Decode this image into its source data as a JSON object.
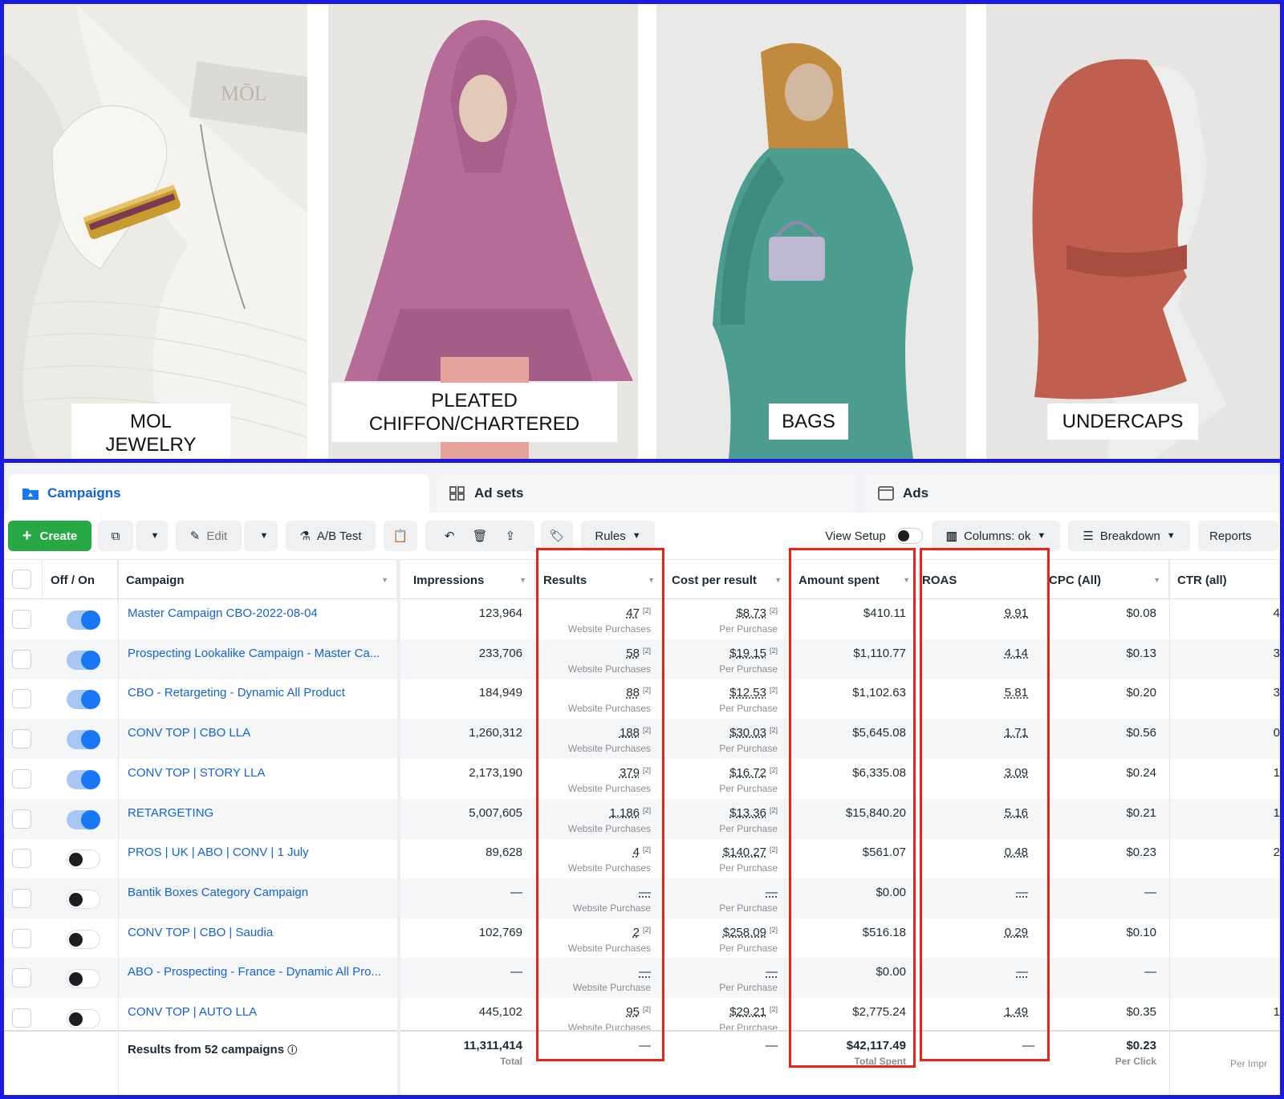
{
  "photos": [
    {
      "caption": "MOL JEWELRY"
    },
    {
      "caption_line1": "PLEATED",
      "caption_line2": "CHIFFON/CHARTERED"
    },
    {
      "caption": "BAGS"
    },
    {
      "caption": "UNDERCAPS"
    }
  ],
  "tabs": {
    "campaigns": "Campaigns",
    "adsets": "Ad sets",
    "ads": "Ads"
  },
  "toolbar": {
    "create": "Create",
    "edit": "Edit",
    "ab_test": "A/B Test",
    "rules": "Rules",
    "view_setup": "View Setup",
    "columns": "Columns: ok",
    "breakdown": "Breakdown",
    "reports": "Reports"
  },
  "columns": {
    "offon": "Off / On",
    "campaign": "Campaign",
    "impressions": "Impressions",
    "results": "Results",
    "cost": "Cost per result",
    "spent": "Amount spent",
    "roas": "ROAS",
    "cpc": "CPC (All)",
    "ctr": "CTR (all)"
  },
  "rows": [
    {
      "name": "Master Campaign CBO-2022-08-04",
      "on": true,
      "impressions": "123,964",
      "results": "47",
      "results_sub": "Website Purchases",
      "cost": "$8.73",
      "cost_sub": "Per Purchase",
      "spent": "$410.11",
      "roas": "9.91",
      "cpc": "$0.08",
      "ctr": "4"
    },
    {
      "name": "Prospecting Lookalike Campaign - Master Ca...",
      "on": true,
      "impressions": "233,706",
      "results": "58",
      "results_sub": "Website Purchases",
      "cost": "$19.15",
      "cost_sub": "Per Purchase",
      "spent": "$1,110.77",
      "roas": "4.14",
      "cpc": "$0.13",
      "ctr": "3"
    },
    {
      "name": "CBO - Retargeting - Dynamic All Product",
      "on": true,
      "impressions": "184,949",
      "results": "88",
      "results_sub": "Website Purchases",
      "cost": "$12.53",
      "cost_sub": "Per Purchase",
      "spent": "$1,102.63",
      "roas": "5.81",
      "cpc": "$0.20",
      "ctr": "3"
    },
    {
      "name": "CONV TOP | CBO LLA",
      "on": true,
      "impressions": "1,260,312",
      "results": "188",
      "results_sub": "Website Purchases",
      "cost": "$30.03",
      "cost_sub": "Per Purchase",
      "spent": "$5,645.08",
      "roas": "1.71",
      "cpc": "$0.56",
      "ctr": "0"
    },
    {
      "name": "CONV TOP | STORY LLA",
      "on": true,
      "impressions": "2,173,190",
      "results": "379",
      "results_sub": "Website Purchases",
      "cost": "$16.72",
      "cost_sub": "Per Purchase",
      "spent": "$6,335.08",
      "roas": "3.09",
      "cpc": "$0.24",
      "ctr": "1"
    },
    {
      "name": "RETARGETING",
      "on": true,
      "impressions": "5,007,605",
      "results": "1,186",
      "results_sub": "Website Purchases",
      "cost": "$13.36",
      "cost_sub": "Per Purchase",
      "spent": "$15,840.20",
      "roas": "5.16",
      "cpc": "$0.21",
      "ctr": "1"
    },
    {
      "name": "PROS | UK | ABO | CONV | 1 July",
      "on": false,
      "impressions": "89,628",
      "results": "4",
      "results_sub": "Website Purchases",
      "cost": "$140.27",
      "cost_sub": "Per Purchase",
      "spent": "$561.07",
      "roas": "0.48",
      "cpc": "$0.23",
      "ctr": "2"
    },
    {
      "name": "Bantik Boxes Category Campaign",
      "on": false,
      "impressions": "—",
      "results": "—",
      "results_sub": "Website Purchase",
      "cost": "—",
      "cost_sub": "Per Purchase",
      "spent": "$0.00",
      "roas": "—",
      "cpc": "—",
      "ctr": ""
    },
    {
      "name": "CONV TOP | CBO | Saudia",
      "on": false,
      "impressions": "102,769",
      "results": "2",
      "results_sub": "Website Purchases",
      "cost": "$258.09",
      "cost_sub": "Per Purchase",
      "spent": "$516.18",
      "roas": "0.29",
      "cpc": "$0.10",
      "ctr": ""
    },
    {
      "name": "ABO - Prospecting - France - Dynamic All Pro...",
      "on": false,
      "impressions": "—",
      "results": "—",
      "results_sub": "Website Purchase",
      "cost": "—",
      "cost_sub": "Per Purchase",
      "spent": "$0.00",
      "roas": "—",
      "cpc": "—",
      "ctr": ""
    },
    {
      "name": "CONV TOP | AUTO LLA",
      "on": false,
      "impressions": "445,102",
      "results": "95",
      "results_sub": "Website Purchases",
      "cost": "$29.21",
      "cost_sub": "Per Purchase",
      "spent": "$2,775.24",
      "roas": "1.49",
      "cpc": "$0.35",
      "ctr": "1"
    }
  ],
  "totals": {
    "label": "Results from 52 campaigns",
    "impressions": "11,311,414",
    "impressions_sub": "Total",
    "results": "—",
    "cost": "—",
    "spent": "$42,117.49",
    "spent_sub": "Total Spent",
    "roas": "—",
    "cpc": "$0.23",
    "cpc_sub": "Per Click",
    "ctr_sub": "Per Impr"
  },
  "colors": {
    "highlight": "#e8231b",
    "frame": "#1a1ae0",
    "link": "#1463cf",
    "create": "#28a745"
  }
}
